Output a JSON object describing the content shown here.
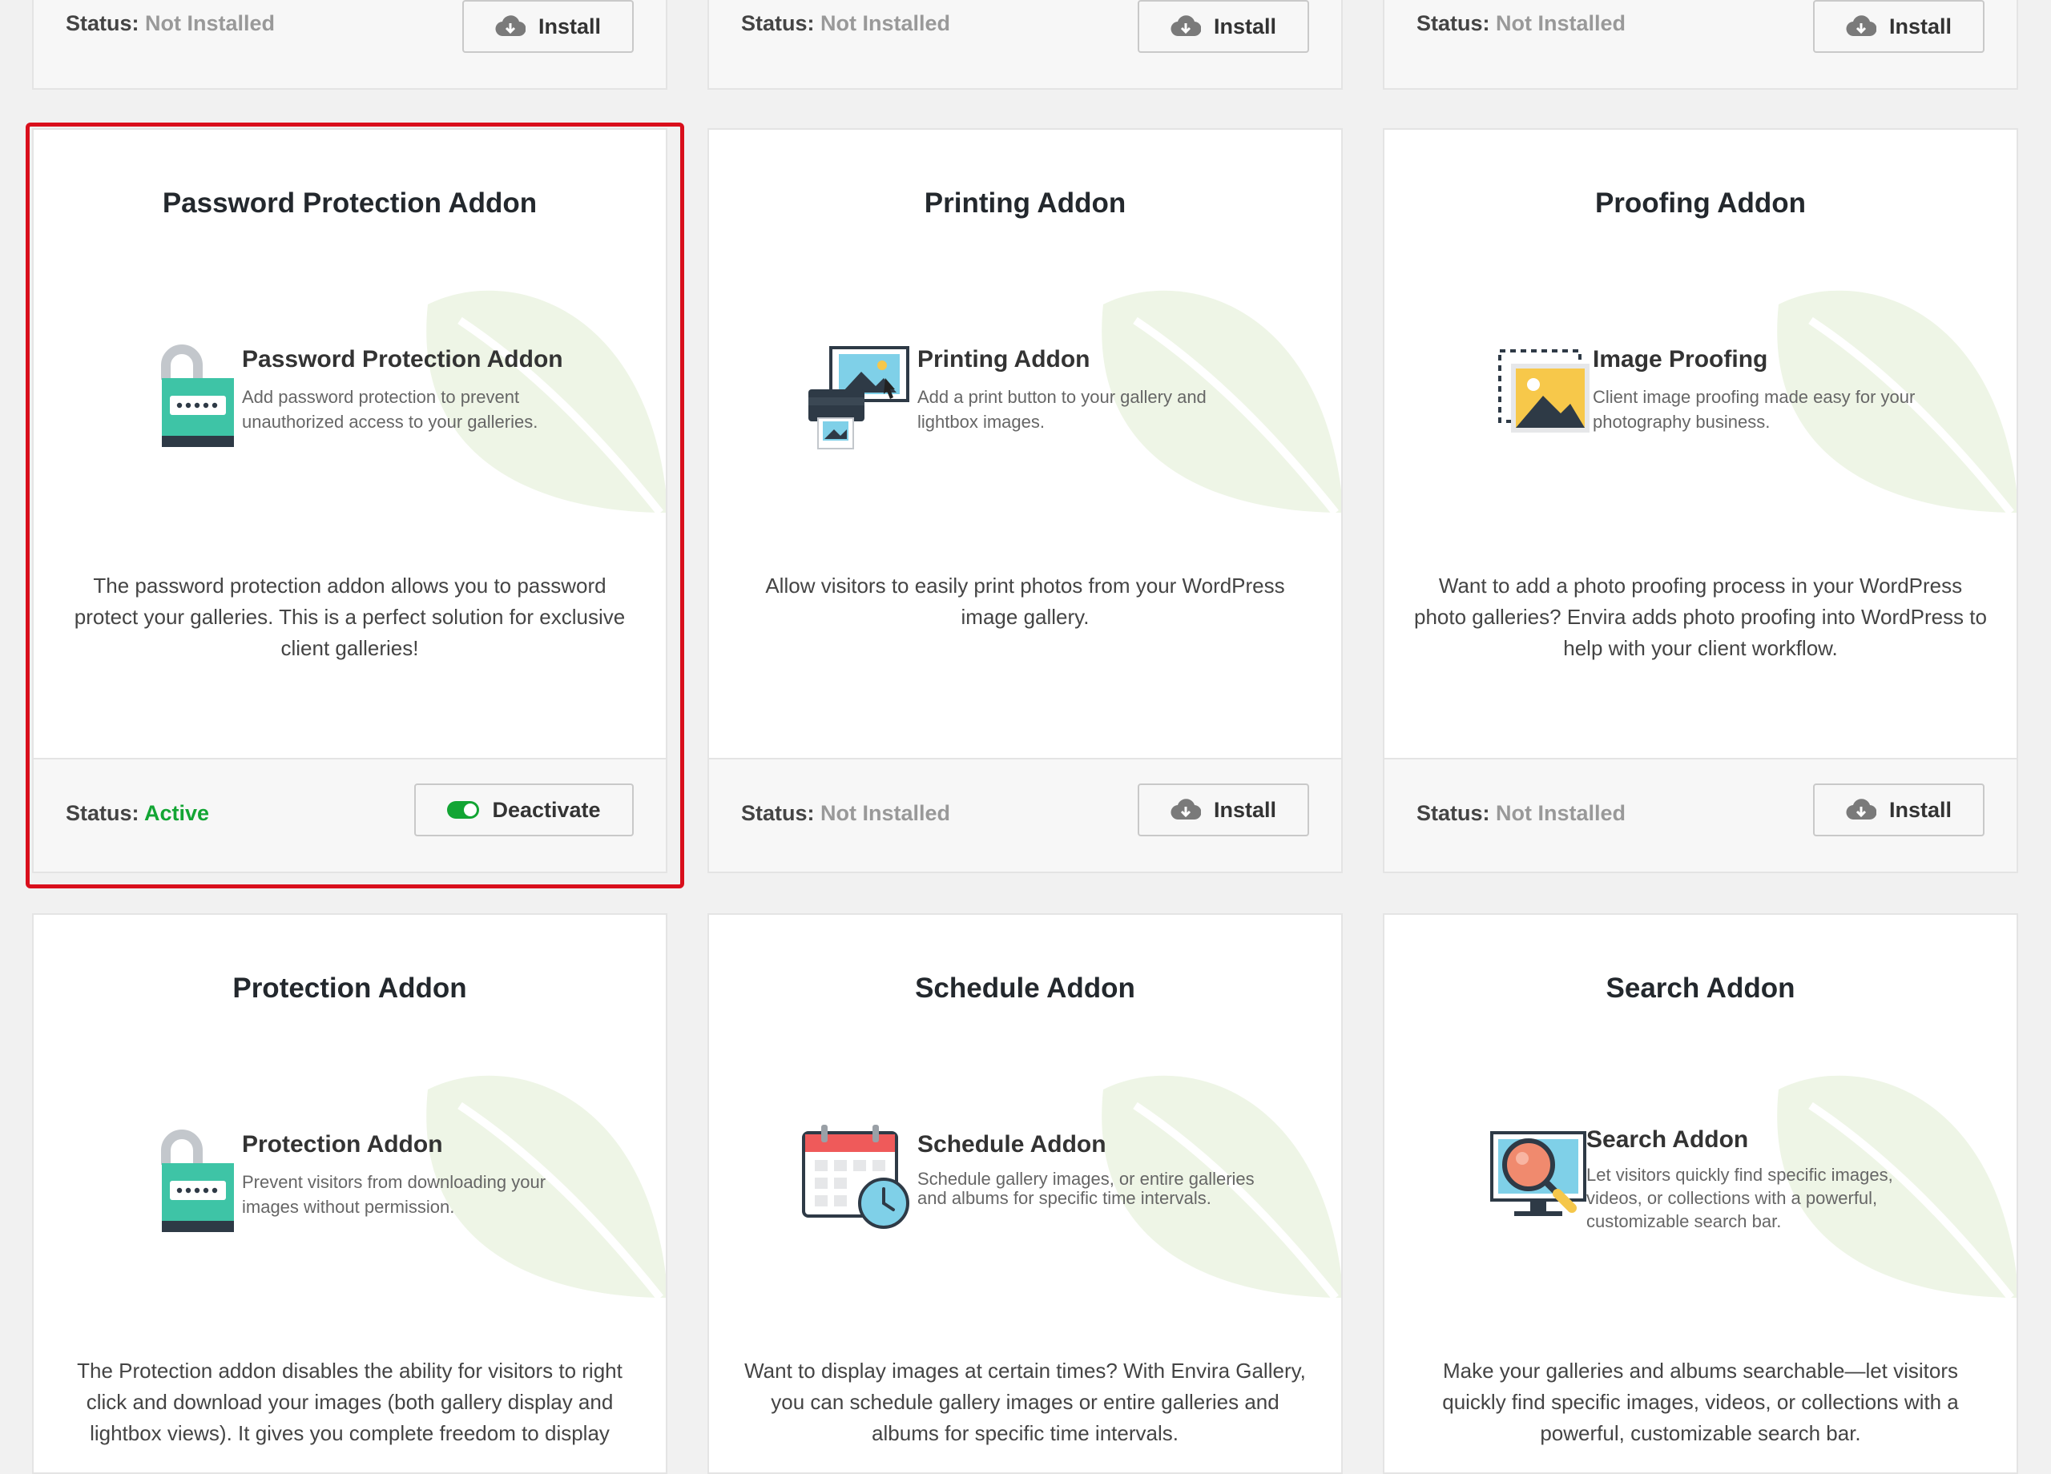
{
  "labels": {
    "status_prefix": "Status:",
    "install": "Install",
    "deactivate": "Deactivate"
  },
  "colors": {
    "active": "#13a534",
    "not_installed": "#999999",
    "highlight": "#d90f1c",
    "leaf": "#eef5e6"
  },
  "top_row": [
    {
      "status": "Not Installed",
      "button": "Install"
    },
    {
      "status": "Not Installed",
      "button": "Install"
    },
    {
      "status": "Not Installed",
      "button": "Install"
    }
  ],
  "addons": [
    {
      "title": "Password Protection Addon",
      "icon": "padlock-icon",
      "feature_name": "Password Protection Addon",
      "feature_desc": "Add password protection to prevent unauthorized access to your galleries.",
      "description": "The password protection addon allows you to password protect your galleries. This is a perfect solution for exclusive client galleries!",
      "status": "Active",
      "button": "Deactivate"
    },
    {
      "title": "Printing Addon",
      "icon": "printer-icon",
      "feature_name": "Printing Addon",
      "feature_desc": "Add a print button to your gallery and lightbox images.",
      "description": "Allow visitors to easily print photos from your WordPress image gallery.",
      "status": "Not Installed",
      "button": "Install"
    },
    {
      "title": "Proofing Addon",
      "icon": "image-proofing-icon",
      "feature_name": "Image Proofing",
      "feature_desc": "Client image proofing made easy for your photography business.",
      "description": "Want to add a photo proofing process in your WordPress photo galleries? Envira adds photo proofing into WordPress to help with your client workflow.",
      "status": "Not Installed",
      "button": "Install"
    },
    {
      "title": "Protection Addon",
      "icon": "padlock-icon",
      "feature_name": "Protection Addon",
      "feature_desc": "Prevent visitors from downloading your images without permission.",
      "description": "The Protection addon disables the ability for visitors to right click and download your images (both gallery display and lightbox views). It gives you complete freedom to display"
    },
    {
      "title": "Schedule Addon",
      "icon": "calendar-clock-icon",
      "feature_name": "Schedule Addon",
      "feature_desc": "Schedule gallery images, or entire galleries and albums for specific time intervals.",
      "description": "Want to display images at certain times? With Envira Gallery, you can schedule gallery images or entire galleries and albums for specific time intervals."
    },
    {
      "title": "Search Addon",
      "icon": "magnifier-monitor-icon",
      "feature_name": "Search Addon",
      "feature_desc": "Let visitors quickly find specific images, videos, or collections with a powerful, customizable search bar.",
      "description": "Make your galleries and albums searchable—let visitors quickly find specific images, videos, or collections with a powerful, customizable search bar."
    }
  ]
}
